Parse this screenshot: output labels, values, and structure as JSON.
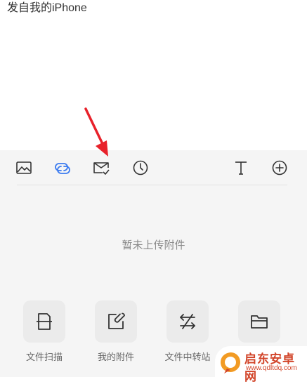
{
  "compose": {
    "signature": "发自我的iPhone"
  },
  "toolbar": {
    "icons": [
      "image-icon",
      "attachment-link-icon",
      "mail-check-icon",
      "clock-icon",
      "text-format-icon",
      "add-circle-icon"
    ],
    "active_color": "#3b7bf0"
  },
  "attachments": {
    "empty_text": "暂未上传附件"
  },
  "actions": [
    {
      "label": "文件扫描",
      "icon": "scan-document-icon"
    },
    {
      "label": "我的附件",
      "icon": "edit-attachment-icon"
    },
    {
      "label": "文件中转站",
      "icon": "transfer-icon"
    },
    {
      "label": "",
      "icon": "folder-icon"
    }
  ],
  "annotation": {
    "arrow_color": "#e8212a"
  },
  "watermark": {
    "title": "启东安卓网",
    "url": "www.qdltdq.com"
  }
}
